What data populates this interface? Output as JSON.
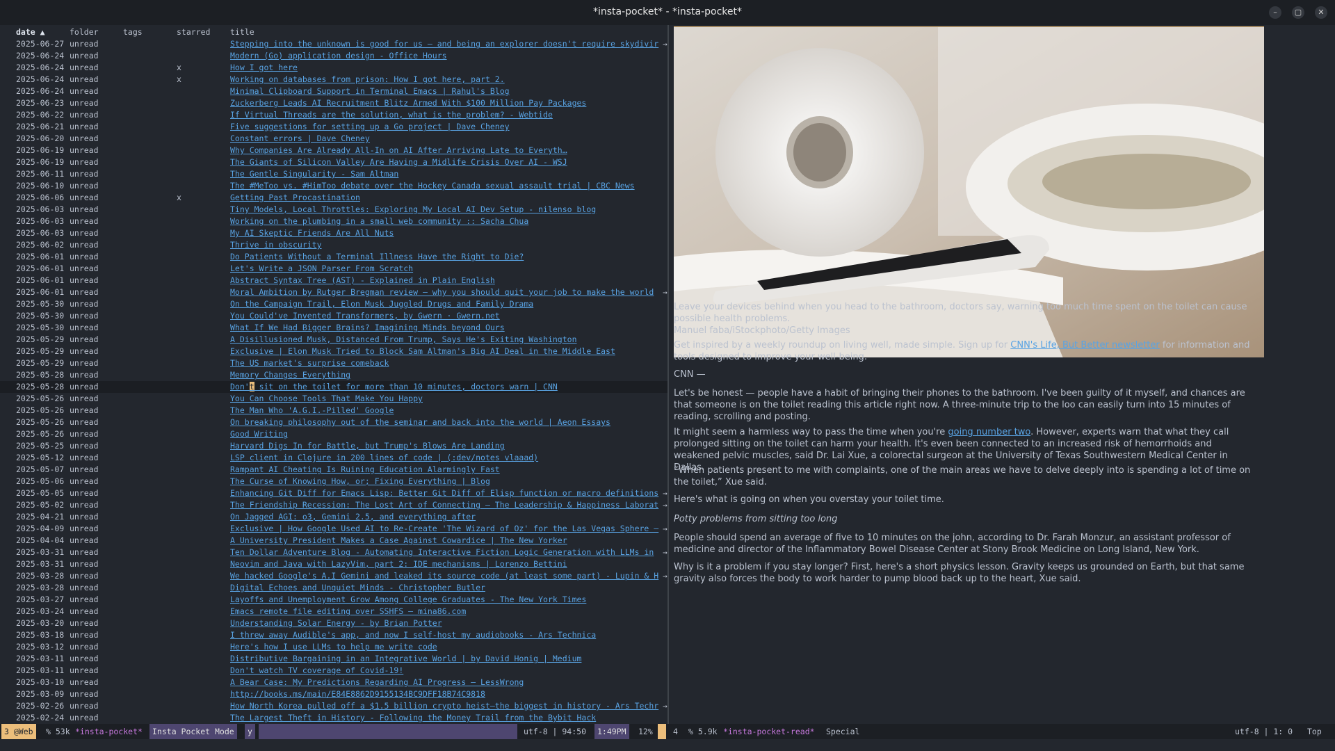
{
  "window": {
    "title": "*insta-pocket* - *insta-pocket*",
    "controls": [
      "minimize-icon",
      "maximize-icon",
      "close-icon"
    ]
  },
  "list": {
    "columns": {
      "date": "date ▲",
      "folder": "folder",
      "tags": "tags",
      "starred": "starred",
      "title": "title"
    },
    "selected_index": 29,
    "rows": [
      {
        "date": "2025-06-27",
        "folder": "unread",
        "starred": "",
        "title": "Stepping into the unknown is good for us — and being an explorer doesn't require skydivir",
        "truncated": true
      },
      {
        "date": "2025-06-24",
        "folder": "unread",
        "starred": "",
        "title": "Modern (Go) application design - Office Hours",
        "truncated": false
      },
      {
        "date": "2025-06-24",
        "folder": "unread",
        "starred": "x",
        "title": "How I got here",
        "truncated": false
      },
      {
        "date": "2025-06-24",
        "folder": "unread",
        "starred": "x",
        "title": "Working on databases from prison: How I got here, part 2.",
        "truncated": false
      },
      {
        "date": "2025-06-24",
        "folder": "unread",
        "starred": "",
        "title": "Minimal Clipboard Support in Terminal Emacs | Rahul's Blog",
        "truncated": false
      },
      {
        "date": "2025-06-23",
        "folder": "unread",
        "starred": "",
        "title": "Zuckerberg Leads AI Recruitment Blitz Armed With $100 Million Pay Packages",
        "truncated": false
      },
      {
        "date": "2025-06-22",
        "folder": "unread",
        "starred": "",
        "title": "If Virtual Threads are the solution, what is the problem? - Webtide",
        "truncated": false
      },
      {
        "date": "2025-06-21",
        "folder": "unread",
        "starred": "",
        "title": "Five suggestions for setting up a Go project | Dave Cheney",
        "truncated": false
      },
      {
        "date": "2025-06-20",
        "folder": "unread",
        "starred": "",
        "title": "Constant errors | Dave Cheney",
        "truncated": false
      },
      {
        "date": "2025-06-19",
        "folder": "unread",
        "starred": "",
        "title": "Why Companies Are Already All-In on AI After Arriving Late to Everyth…",
        "truncated": false
      },
      {
        "date": "2025-06-19",
        "folder": "unread",
        "starred": "",
        "title": "The Giants of Silicon Valley Are Having a Midlife Crisis Over AI - WSJ",
        "truncated": false
      },
      {
        "date": "2025-06-11",
        "folder": "unread",
        "starred": "",
        "title": "The Gentle Singularity - Sam Altman",
        "truncated": false
      },
      {
        "date": "2025-06-10",
        "folder": "unread",
        "starred": "",
        "title": "The #MeToo vs. #HimToo debate over the Hockey Canada sexual assault trial | CBC News",
        "truncated": false
      },
      {
        "date": "2025-06-06",
        "folder": "unread",
        "starred": "x",
        "title": "Getting Past Procastination",
        "truncated": false
      },
      {
        "date": "2025-06-03",
        "folder": "unread",
        "starred": "",
        "title": "Tiny Models, Local Throttles: Exploring My Local AI Dev Setup - nilenso blog",
        "truncated": false
      },
      {
        "date": "2025-06-03",
        "folder": "unread",
        "starred": "",
        "title": "Working on the plumbing in a small web community :: Sacha Chua",
        "truncated": false
      },
      {
        "date": "2025-06-03",
        "folder": "unread",
        "starred": "",
        "title": "My AI Skeptic Friends Are All Nuts",
        "truncated": false
      },
      {
        "date": "2025-06-02",
        "folder": "unread",
        "starred": "",
        "title": "Thrive in obscurity",
        "truncated": false
      },
      {
        "date": "2025-06-01",
        "folder": "unread",
        "starred": "",
        "title": "Do Patients Without a Terminal Illness Have the Right to Die?",
        "truncated": false
      },
      {
        "date": "2025-06-01",
        "folder": "unread",
        "starred": "",
        "title": "Let's Write a JSON Parser From Scratch",
        "truncated": false
      },
      {
        "date": "2025-06-01",
        "folder": "unread",
        "starred": "",
        "title": "Abstract Syntax Tree (AST) - Explained in Plain English",
        "truncated": false
      },
      {
        "date": "2025-06-01",
        "folder": "unread",
        "starred": "",
        "title": "Moral Ambition by Rutger Bregman review – why you should quit your job to make the world",
        "truncated": true
      },
      {
        "date": "2025-05-30",
        "folder": "unread",
        "starred": "",
        "title": "On the Campaign Trail, Elon Musk Juggled Drugs and Family Drama",
        "truncated": false
      },
      {
        "date": "2025-05-30",
        "folder": "unread",
        "starred": "",
        "title": "You Could've Invented Transformers, by Gwern · Gwern.net",
        "truncated": false
      },
      {
        "date": "2025-05-30",
        "folder": "unread",
        "starred": "",
        "title": "What If We Had Bigger Brains? Imagining Minds beyond Ours",
        "truncated": false
      },
      {
        "date": "2025-05-29",
        "folder": "unread",
        "starred": "",
        "title": "A Disillusioned Musk, Distanced From Trump, Says He's Exiting Washington",
        "truncated": false
      },
      {
        "date": "2025-05-29",
        "folder": "unread",
        "starred": "",
        "title": "Exclusive | Elon Musk Tried to Block Sam Altman's Big AI Deal in the Middle East",
        "truncated": false
      },
      {
        "date": "2025-05-29",
        "folder": "unread",
        "starred": "",
        "title": "The US market's surprise comeback",
        "truncated": false
      },
      {
        "date": "2025-05-28",
        "folder": "unread",
        "starred": "",
        "title": "Memory Changes Everything",
        "truncated": false
      },
      {
        "date": "2025-05-28",
        "folder": "unread",
        "starred": "",
        "title": "Don't sit on the toilet for more than 10 minutes, doctors warn | CNN",
        "truncated": false
      },
      {
        "date": "2025-05-26",
        "folder": "unread",
        "starred": "",
        "title": "You Can Choose Tools That Make You Happy",
        "truncated": false
      },
      {
        "date": "2025-05-26",
        "folder": "unread",
        "starred": "",
        "title": "The Man Who 'A.G.I.-Pilled' Google",
        "truncated": false
      },
      {
        "date": "2025-05-26",
        "folder": "unread",
        "starred": "",
        "title": "On breaking philosophy out of the seminar and back into the world | Aeon Essays",
        "truncated": false
      },
      {
        "date": "2025-05-26",
        "folder": "unread",
        "starred": "",
        "title": "Good Writing",
        "truncated": false
      },
      {
        "date": "2025-05-25",
        "folder": "unread",
        "starred": "",
        "title": "Harvard Digs In for Battle, but Trump's Blows Are Landing",
        "truncated": false
      },
      {
        "date": "2025-05-12",
        "folder": "unread",
        "starred": "",
        "title": "LSP client in Clojure in 200 lines of code | (:dev/notes vlaaad)",
        "truncated": false
      },
      {
        "date": "2025-05-07",
        "folder": "unread",
        "starred": "",
        "title": "Rampant AI Cheating Is Ruining Education Alarmingly Fast",
        "truncated": false
      },
      {
        "date": "2025-05-06",
        "folder": "unread",
        "starred": "",
        "title": "The Curse of Knowing How, or; Fixing Everything | Blog",
        "truncated": false
      },
      {
        "date": "2025-05-05",
        "folder": "unread",
        "starred": "",
        "title": "Enhancing Git Diff for Emacs Lisp: Better Git Diff of Elisp function or macro definitions",
        "truncated": true
      },
      {
        "date": "2025-05-02",
        "folder": "unread",
        "starred": "",
        "title": "The Friendship Recession: The Lost Art of Connecting — The Leadership & Happiness Laborat",
        "truncated": true
      },
      {
        "date": "2025-04-21",
        "folder": "unread",
        "starred": "",
        "title": "On Jagged AGI: o3, Gemini 2.5, and everything after",
        "truncated": false
      },
      {
        "date": "2025-04-09",
        "folder": "unread",
        "starred": "",
        "title": "Exclusive | How Google Used AI to Re-Create 'The Wizard of Oz' for the Las Vegas Sphere –",
        "truncated": true
      },
      {
        "date": "2025-04-04",
        "folder": "unread",
        "starred": "",
        "title": "A University President Makes a Case Against Cowardice | The New Yorker",
        "truncated": false
      },
      {
        "date": "2025-03-31",
        "folder": "unread",
        "starred": "",
        "title": "Ten Dollar Adventure Blog - Automating Interactive Fiction Logic Generation with LLMs in",
        "truncated": true
      },
      {
        "date": "2025-03-31",
        "folder": "unread",
        "starred": "",
        "title": "Neovim and Java with LazyVim, part 2: IDE mechanisms | Lorenzo Bettini",
        "truncated": false
      },
      {
        "date": "2025-03-28",
        "folder": "unread",
        "starred": "",
        "title": "We hacked Google's A.I Gemini and leaked its source code (at least some part) - Lupin & H",
        "truncated": true
      },
      {
        "date": "2025-03-28",
        "folder": "unread",
        "starred": "",
        "title": "Digital Echoes and Unquiet Minds - Christopher Butler",
        "truncated": false
      },
      {
        "date": "2025-03-27",
        "folder": "unread",
        "starred": "",
        "title": "Layoffs and Unemployment Grow Among College Graduates - The New York Times",
        "truncated": false
      },
      {
        "date": "2025-03-24",
        "folder": "unread",
        "starred": "",
        "title": "Emacs remote file editing over SSHFS — mina86.com",
        "truncated": false
      },
      {
        "date": "2025-03-20",
        "folder": "unread",
        "starred": "",
        "title": "Understanding Solar Energy - by Brian Potter",
        "truncated": false
      },
      {
        "date": "2025-03-18",
        "folder": "unread",
        "starred": "",
        "title": "I threw away Audible's app, and now I self-host my audiobooks - Ars Technica",
        "truncated": false
      },
      {
        "date": "2025-03-12",
        "folder": "unread",
        "starred": "",
        "title": "Here's how I use LLMs to help me write code",
        "truncated": false
      },
      {
        "date": "2025-03-11",
        "folder": "unread",
        "starred": "",
        "title": "Distributive Bargaining in an Integrative World | by David Honig | Medium",
        "truncated": false
      },
      {
        "date": "2025-03-11",
        "folder": "unread",
        "starred": "",
        "title": "Don't watch TV coverage of Covid-19!",
        "truncated": false
      },
      {
        "date": "2025-03-10",
        "folder": "unread",
        "starred": "",
        "title": "A Bear Case: My Predictions Regarding AI Progress — LessWrong",
        "truncated": false
      },
      {
        "date": "2025-03-09",
        "folder": "unread",
        "starred": "",
        "title": "http://books.ms/main/E84E8862D9155134BC9DFF18B74C9818",
        "truncated": false
      },
      {
        "date": "2025-02-26",
        "folder": "unread",
        "starred": "",
        "title": "How North Korea pulled off a $1.5 billion crypto heist—the biggest in history - Ars Techr",
        "truncated": true
      },
      {
        "date": "2025-02-24",
        "folder": "unread",
        "starred": "",
        "title": "The Largest Theft in History - Following the Money Trail from the Bybit Hack",
        "truncated": false
      }
    ]
  },
  "article": {
    "p1": "Leave your devices behind when you head to the bathroom, doctors say, warning too much time spent on the toilet can cause possible health problems.",
    "p1_credit": "Manuel faba/iStockphoto/Getty Images",
    "p2_before": "Get inspired by a weekly roundup on living well, made simple. Sign up for ",
    "p2_link": "CNN's Life, But Better newsletter",
    "p2_after": " for information and tools designed to improve your well-being.",
    "p3": "CNN —",
    "p4": "Let's be honest — people have a habit of bringing their phones to the bathroom. I've been guilty of it myself, and chances are that someone is on the toilet reading this article right now. A three-minute trip to the loo can easily turn into 15 minutes of reading, scrolling and posting.",
    "p5_before": "It might seem a harmless way to pass the time when you're ",
    "p5_link": "going number two",
    "p5_after": ". However, experts warn that what they call prolonged sitting on the toilet can harm your health. It's even been connected to an increased risk of hemorrhoids and weakened pelvic muscles, said Dr. Lai Xue, a colorectal surgeon at the University of Texas Southwestern Medical Center in Dallas.",
    "p6": "“When patients present to me with complaints, one of the main areas we have to delve deeply into is spending a lot of time on the toilet,” Xue said.",
    "p7": "Here's what is going on when you overstay your toilet time.",
    "p8": "Potty problems from sitting too long",
    "p9": "People should spend an average of five to 10 minutes on the john, according to Dr. Farah Monzur, an assistant professor of medicine and director of the Inflammatory Bowel Disease Center at Stony Brook Medicine on Long Island, New York.",
    "p10": "Why is it a problem if you stay longer? First, here's a short physics lesson. Gravity keeps us grounded on Earth, but that same gravity also forces the body to work harder to pump blood back up to the heart, Xue said."
  },
  "statusbar": {
    "workspace": "3 @Web",
    "left_size": "% 53k",
    "left_buffer": "*insta-pocket*",
    "left_mode": "Insta Pocket Mode",
    "left_flag": "y",
    "left_encoding": "utf-8 | 94:50",
    "clock": "1:49PM",
    "left_percent": "12%",
    "right_window": "4",
    "right_size": "% 5.9k",
    "right_buffer": "*insta-pocket-read*",
    "right_mode": "Special",
    "right_encoding": "utf-8 | 1: 0",
    "right_position": "Top"
  },
  "colors": {
    "background": "#23272e",
    "link": "#59a3e3",
    "cursor": "#ecbe7b",
    "mode_bg": "#4e4670",
    "buffer_name": "#c678dd"
  }
}
